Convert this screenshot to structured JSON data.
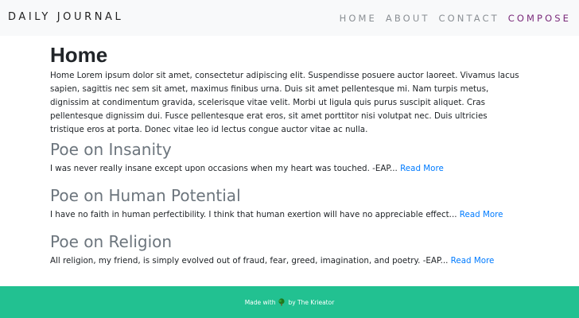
{
  "navbar": {
    "brand": "DAILY JOURNAL",
    "links": [
      {
        "label": "HOME"
      },
      {
        "label": "ABOUT"
      },
      {
        "label": "CONTACT"
      },
      {
        "label": "COMPOSE"
      }
    ]
  },
  "home": {
    "title": "Home",
    "body": "Home Lorem ipsum dolor sit amet, consectetur adipiscing elit. Suspendisse posuere auctor laoreet. Vivamus lacus sapien, sagittis nec sem sit amet, maximus finibus urna. Duis sit amet pellentesque mi. Nam turpis metus, dignissim at condimentum gravida, scelerisque vitae velit. Morbi ut ligula quis purus suscipit aliquet. Cras pellentesque dignissim dui. Fusce pellentesque erat eros, sit amet porttitor nisi volutpat nec. Duis ultricies tristique eros at porta. Donec vitae leo id lectus congue auctor vitae ac nulla."
  },
  "posts": [
    {
      "title": "Poe on Insanity",
      "excerpt": "I was never really insane except upon occasions when my heart was touched. -EAP...",
      "read_more": "Read More"
    },
    {
      "title": "Poe on Human Potential",
      "excerpt": "I have no faith in human perfectibility. I think that human exertion will have no appreciable effect...",
      "read_more": "Read More"
    },
    {
      "title": "Poe on Religion",
      "excerpt": "All religion, my friend, is simply evolved out of fraud, fear, greed, imagination, and poetry. -EAP...",
      "read_more": "Read More"
    }
  ],
  "footer": {
    "made_with": "Made with",
    "by": "by The Krieator",
    "icon": "tree-icon"
  },
  "colors": {
    "navbar_bg": "#f8f9fa",
    "active_link": "#7a2a7a",
    "link": "#007bff",
    "footer_bg": "#22c191"
  }
}
